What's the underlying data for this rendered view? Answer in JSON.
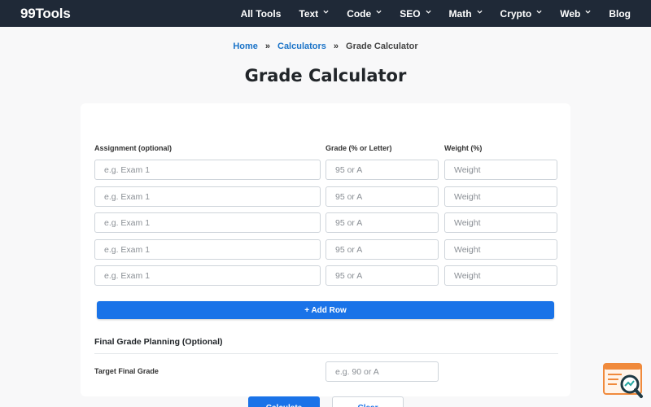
{
  "brand": "99Tools",
  "nav": {
    "items": [
      {
        "label": "All Tools",
        "dropdown": false
      },
      {
        "label": "Text",
        "dropdown": true
      },
      {
        "label": "Code",
        "dropdown": true
      },
      {
        "label": "SEO",
        "dropdown": true
      },
      {
        "label": "Math",
        "dropdown": true
      },
      {
        "label": "Crypto",
        "dropdown": true
      },
      {
        "label": "Web",
        "dropdown": true
      },
      {
        "label": "Blog",
        "dropdown": false
      }
    ]
  },
  "breadcrumb": {
    "home": "Home",
    "separator": "»",
    "calculators": "Calculators",
    "current": "Grade Calculator"
  },
  "page_title": "Grade Calculator",
  "table": {
    "headers": {
      "assignment": "Assignment (optional)",
      "grade": "Grade (% or Letter)",
      "weight": "Weight (%)"
    },
    "placeholders": {
      "assignment": "e.g. Exam 1",
      "grade": "95 or A",
      "weight": "Weight"
    },
    "rows": [
      {
        "assignment": "",
        "grade": "",
        "weight": ""
      },
      {
        "assignment": "",
        "grade": "",
        "weight": ""
      },
      {
        "assignment": "",
        "grade": "",
        "weight": ""
      },
      {
        "assignment": "",
        "grade": "",
        "weight": ""
      },
      {
        "assignment": "",
        "grade": "",
        "weight": ""
      }
    ]
  },
  "add_row_label": "+ Add Row",
  "final_planning": {
    "title": "Final Grade Planning (Optional)",
    "target_label": "Target Final Grade",
    "target_placeholder": "e.g. 90 or A",
    "target_value": ""
  },
  "actions": {
    "calculate": "Calculate",
    "clear": "Clear"
  },
  "colors": {
    "nav_bg": "#1f2937",
    "primary": "#1a73e8",
    "link": "#1a73c8",
    "widget_accent": "#f08a3c",
    "widget_dark": "#1f3a44"
  },
  "icons": {
    "nav_dropdown": "chevron-down-icon",
    "floating_widget": "search-magnifier-icon"
  }
}
